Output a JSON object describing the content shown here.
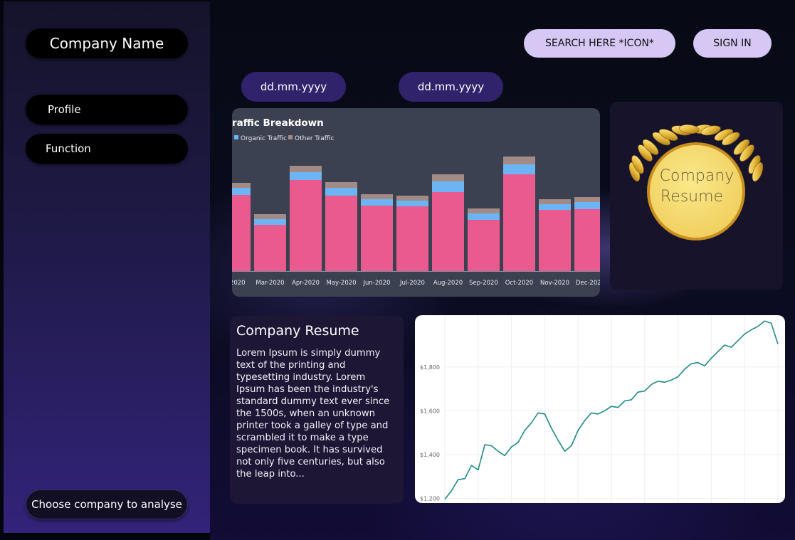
{
  "sidebar": {
    "company_name": "Company Name",
    "nav": [
      "Profile",
      "Function"
    ],
    "choose_label": "Choose company to analyse"
  },
  "header": {
    "search_label": "SEARCH HERE *ICON*",
    "signin_label": "SIGN IN"
  },
  "filters": {
    "start_date": "dd.mm.yyyy",
    "end_date": "dd.mm.yyyy"
  },
  "resume_badge": {
    "line1": "Company",
    "line2": "Resume"
  },
  "resume_card": {
    "title": "Company Resume",
    "body": "Lorem Ipsum is simply dummy text of the printing and typesetting industry. Lorem Ipsum has been the industry's standard dummy text ever since the 1500s, when an unknown printer took a galley of type and scrambled it to make a type specimen book. It has survived not only five centuries, but also the leap into..."
  },
  "colors": {
    "accent": "#d7c7f4",
    "date_pill": "#31236b",
    "main_series": "#e95b8f",
    "organic": "#6cb4f3",
    "other": "#a28a86",
    "line": "#1f8a86"
  },
  "chart_data": [
    {
      "type": "bar",
      "title": "raffic Breakdown",
      "categories": [
        "b-2020",
        "Mar-2020",
        "Apr-2020",
        "May-2020",
        "Jun-2020",
        "Jul-2020",
        "Aug-2020",
        "Sep-2020",
        "Oct-2020",
        "Nov-2020",
        "Dec-2020"
      ],
      "series": [
        {
          "name": "",
          "values": [
            107,
            65,
            128,
            106,
            92,
            91,
            111,
            72,
            136,
            86,
            87
          ]
        },
        {
          "name": "Organic Traffic",
          "values": [
            10,
            8,
            11,
            11,
            9,
            8,
            15,
            9,
            14,
            8,
            10
          ]
        },
        {
          "name": "Other Traffic",
          "values": [
            7,
            7,
            9,
            8,
            7,
            7,
            10,
            7,
            11,
            7,
            7
          ]
        }
      ],
      "stacked": true,
      "legend": "top-left",
      "grid": false,
      "ylim": [
        0,
        162
      ]
    },
    {
      "type": "line",
      "y_tick_labels": [
        "$1,200",
        "$1,400",
        "$1,600",
        "$1,800"
      ],
      "ylim": [
        1185,
        2030
      ],
      "x": [
        0,
        1,
        2,
        3,
        4,
        5,
        6,
        7,
        8,
        9,
        10,
        11,
        12,
        13,
        14,
        15,
        16,
        17,
        18,
        19,
        20,
        21,
        22,
        23,
        24,
        25,
        26,
        27,
        28,
        29,
        30,
        31,
        32,
        33,
        34,
        35,
        36,
        37,
        38,
        39,
        40,
        41,
        42,
        43,
        44,
        45,
        46,
        47,
        48,
        49,
        50
      ],
      "values": [
        1195,
        1235,
        1285,
        1290,
        1350,
        1330,
        1445,
        1440,
        1415,
        1395,
        1435,
        1455,
        1510,
        1545,
        1590,
        1585,
        1520,
        1465,
        1415,
        1440,
        1510,
        1555,
        1590,
        1585,
        1600,
        1620,
        1615,
        1645,
        1650,
        1685,
        1690,
        1720,
        1735,
        1730,
        1740,
        1755,
        1790,
        1815,
        1820,
        1805,
        1840,
        1870,
        1900,
        1890,
        1920,
        1950,
        1970,
        1985,
        2010,
        2000,
        1905
      ],
      "grid": true
    }
  ]
}
